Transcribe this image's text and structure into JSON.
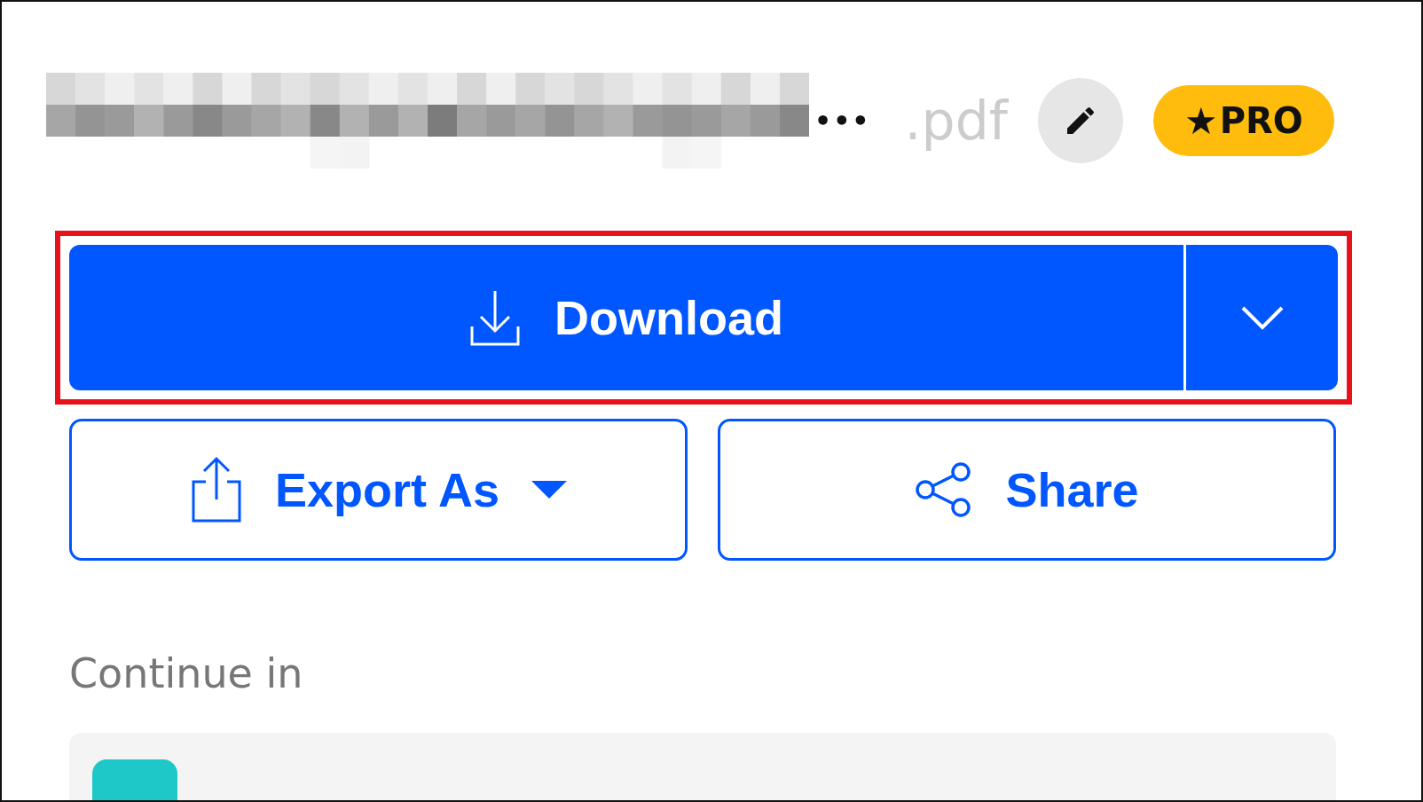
{
  "file": {
    "ellipsis": "•••",
    "extension": ".pdf",
    "badge": {
      "icon": "★",
      "label": "PRO"
    }
  },
  "download": {
    "label": "Download"
  },
  "actions": [
    {
      "kind": "export",
      "label": "Export As"
    },
    {
      "kind": "share",
      "label": "Share"
    }
  ],
  "continue": {
    "heading": "Continue in"
  }
}
